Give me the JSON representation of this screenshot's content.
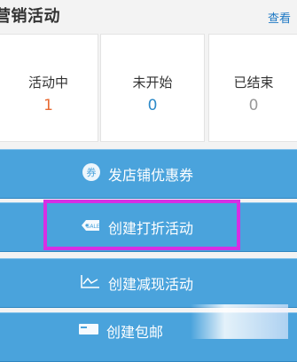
{
  "header": {
    "title": "营销活动",
    "view_link": "查看"
  },
  "stats": [
    {
      "label": "活动中",
      "value": "1",
      "color": "#e86a32"
    },
    {
      "label": "未开始",
      "value": "0",
      "color": "#2d8ac9"
    },
    {
      "label": "已结束",
      "value": "0",
      "color": "#999999"
    }
  ],
  "actions": [
    {
      "label": "发店铺优惠券",
      "icon": "coupon-icon"
    },
    {
      "label": "创建打折活动",
      "icon": "sale-tag-icon"
    },
    {
      "label": "创建减现活动",
      "icon": "line-chart-icon"
    },
    {
      "label": "创建包邮",
      "icon": "card-icon"
    }
  ],
  "colors": {
    "button_bg": "#4aa3dc",
    "highlight": "#d72fe4",
    "link": "#1f79c4"
  }
}
